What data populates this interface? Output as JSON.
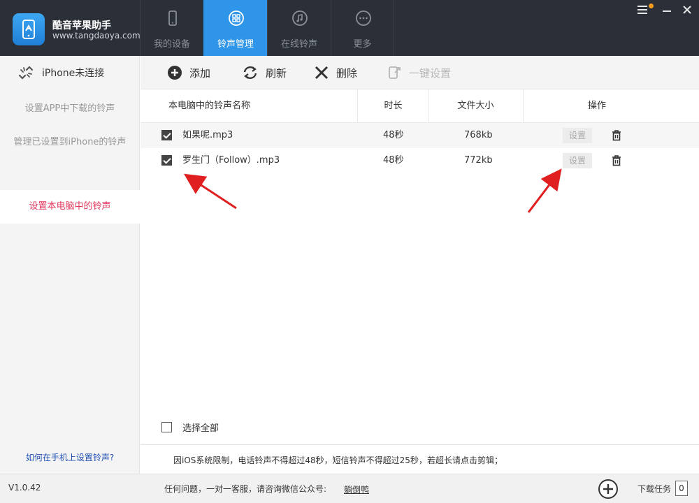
{
  "app": {
    "name": "酷音苹果助手",
    "url": "www.tangdaoya.com"
  },
  "nav": {
    "tabs": [
      {
        "label": "我的设备",
        "icon": "phone-icon",
        "active": false
      },
      {
        "label": "铃声管理",
        "icon": "ringtone-manage-icon",
        "active": true
      },
      {
        "label": "在线铃声",
        "icon": "music-note-icon",
        "active": false
      },
      {
        "label": "更多",
        "icon": "more-dots-icon",
        "active": false
      }
    ]
  },
  "sidebar": {
    "connection": "iPhone未连接",
    "items": [
      {
        "label": "设置APP中下载的铃声"
      },
      {
        "label": "管理已设置到iPhone的铃声"
      },
      {
        "label": "设置本电脑中的铃声"
      }
    ],
    "help_link": "如何在手机上设置铃声?"
  },
  "toolbar": {
    "add": "添加",
    "refresh": "刷新",
    "delete": "删除",
    "one_click_set": "一键设置"
  },
  "table": {
    "headers": {
      "name": "本电脑中的铃声名称",
      "duration": "时长",
      "size": "文件大小",
      "action": "操作"
    },
    "rows": [
      {
        "name": "如果呢.mp3",
        "duration": "48秒",
        "size": "768kb",
        "set_label": "设置",
        "checked": true
      },
      {
        "name": "罗生门（Follow）.mp3",
        "duration": "48秒",
        "size": "772kb",
        "set_label": "设置",
        "checked": true
      }
    ]
  },
  "select_all": "选择全部",
  "notice": "因iOS系统限制，电话铃声不得超过48秒，短信铃声不得超过25秒，若超长请点击剪辑；",
  "footer": {
    "version": "V1.0.42",
    "contact": "任何问题，一对一客服，请咨询微信公众号:",
    "wechat": "躺倒鸭",
    "download_label": "下载任务",
    "download_count": "0"
  },
  "colors": {
    "header_bg": "#2b2f38",
    "accent": "#2f95e8",
    "active_side_text": "#e0355a",
    "annotation": "#e02020"
  }
}
